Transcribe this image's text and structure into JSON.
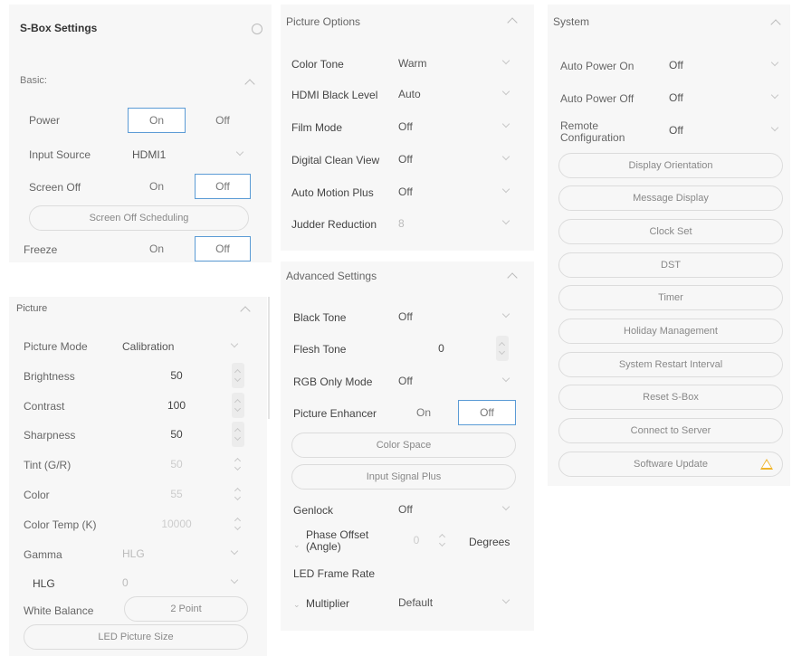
{
  "sbox": {
    "title": "S-Box Settings",
    "icon": "history-icon"
  },
  "basic": {
    "title": "Basic:",
    "power": {
      "label": "Power",
      "on": "On",
      "off": "Off",
      "selected": "On"
    },
    "input_source": {
      "label": "Input Source",
      "value": "HDMI1"
    },
    "screen_off": {
      "label": "Screen Off",
      "on": "On",
      "off": "Off",
      "selected": "Off"
    },
    "screen_off_scheduling": "Screen Off Scheduling",
    "freeze": {
      "label": "Freeze",
      "on": "On",
      "off": "Off",
      "selected": "Off"
    }
  },
  "picture": {
    "title": "Picture",
    "picture_mode": {
      "label": "Picture Mode",
      "value": "Calibration"
    },
    "brightness": {
      "label": "Brightness",
      "value": "50"
    },
    "contrast": {
      "label": "Contrast",
      "value": "100"
    },
    "sharpness": {
      "label": "Sharpness",
      "value": "50"
    },
    "tint": {
      "label": "Tint (G/R)",
      "value": "50"
    },
    "color": {
      "label": "Color",
      "value": "55"
    },
    "color_temp": {
      "label": "Color Temp (K)",
      "value": "10000"
    },
    "gamma": {
      "label": "Gamma",
      "value": "HLG"
    },
    "hlg": {
      "label": "HLG",
      "value": "0"
    },
    "white_balance": {
      "label": "White Balance",
      "button": "2 Point"
    },
    "led_picture_size": "LED Picture Size"
  },
  "picture_options": {
    "title": "Picture Options",
    "color_tone": {
      "label": "Color Tone",
      "value": "Warm"
    },
    "hdmi_black_level": {
      "label": "HDMI Black Level",
      "value": "Auto"
    },
    "film_mode": {
      "label": "Film Mode",
      "value": "Off"
    },
    "digital_clean_view": {
      "label": "Digital Clean View",
      "value": "Off"
    },
    "auto_motion_plus": {
      "label": "Auto Motion Plus",
      "value": "Off"
    },
    "judder_reduction": {
      "label": "Judder Reduction",
      "value": "8"
    }
  },
  "advanced": {
    "title": "Advanced Settings",
    "black_tone": {
      "label": "Black Tone",
      "value": "Off"
    },
    "flesh_tone": {
      "label": "Flesh Tone",
      "value": "0"
    },
    "rgb_only_mode": {
      "label": "RGB Only Mode",
      "value": "Off"
    },
    "picture_enhancer": {
      "label": "Picture Enhancer",
      "on": "On",
      "off": "Off",
      "selected": "Off"
    },
    "color_space": "Color Space",
    "input_signal_plus": "Input Signal Plus",
    "genlock": {
      "label": "Genlock",
      "value": "Off"
    },
    "phase_offset": {
      "label": "Phase Offset (Angle)",
      "value": "0",
      "unit": "Degrees"
    },
    "led_frame_rate": {
      "label": "LED Frame Rate"
    },
    "multiplier": {
      "label": "Multiplier",
      "value": "Default"
    }
  },
  "system": {
    "title": "System",
    "auto_power_on": {
      "label": "Auto Power On",
      "value": "Off"
    },
    "auto_power_off": {
      "label": "Auto Power Off",
      "value": "Off"
    },
    "remote_configuration": {
      "label": "Remote Configuration",
      "value": "Off"
    },
    "buttons": [
      "Display Orientation",
      "Message Display",
      "Clock Set",
      "DST",
      "Timer",
      "Holiday Management",
      "System Restart Interval",
      "Reset S-Box",
      "Connect to Server",
      "Software Update"
    ],
    "warning_icon": "warning-icon"
  },
  "colors": {
    "accent": "#5b9bd5",
    "panel_bg": "#f7f7f7",
    "warning": "#f0b429"
  }
}
